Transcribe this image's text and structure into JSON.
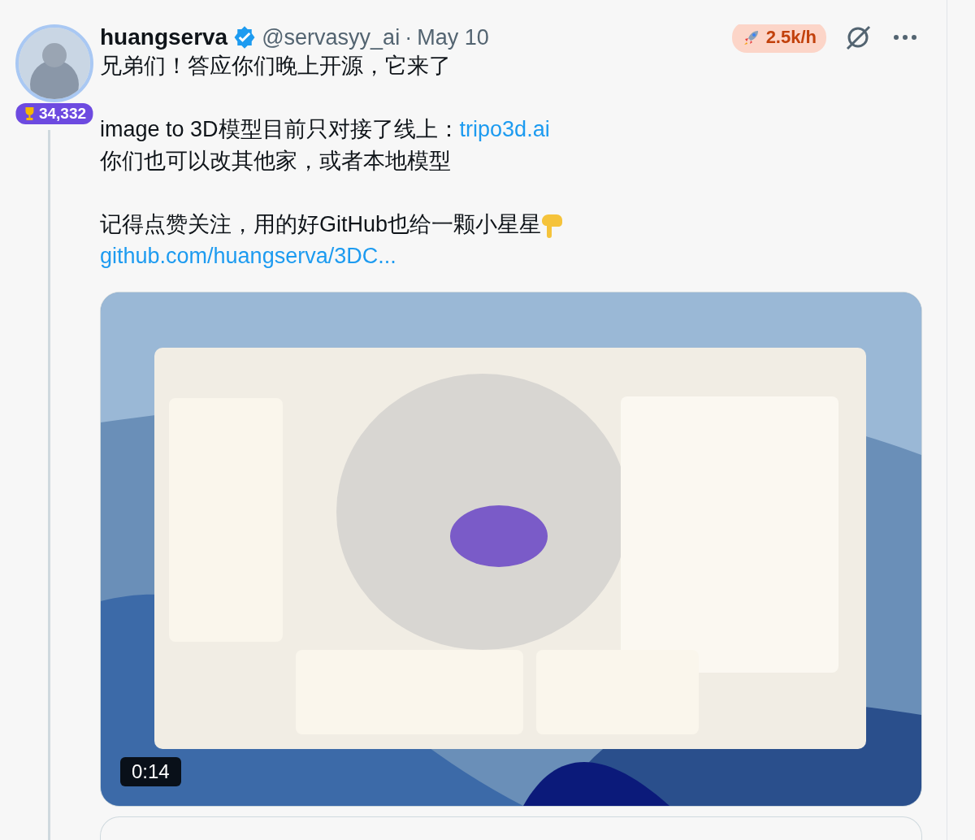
{
  "author": {
    "name": "huangserva",
    "verified": true,
    "handle": "@servasyy_ai",
    "separator": "·",
    "date": "May 10",
    "score": "34,332"
  },
  "rate_badge": "2.5k/h",
  "paragraphs": [
    [
      [
        {
          "kind": "text",
          "text": "兄弟们！答应你们晚上开源，它来了"
        }
      ]
    ],
    [
      [
        {
          "kind": "text",
          "text": "image to 3D模型目前只对接了线上："
        },
        {
          "kind": "link",
          "text": "tripo3d.ai"
        }
      ],
      [
        {
          "kind": "text",
          "text": "你们也可以改其他家，或者本地模型"
        }
      ]
    ],
    [
      [
        {
          "kind": "text",
          "text": "记得点赞关注，用的好GitHub也给一颗小星星"
        },
        {
          "kind": "hand"
        }
      ],
      [
        {
          "kind": "link",
          "text": "github.com/huangserva/3DC..."
        }
      ]
    ]
  ],
  "video": {
    "kind": "picture",
    "duration": "0:14"
  }
}
